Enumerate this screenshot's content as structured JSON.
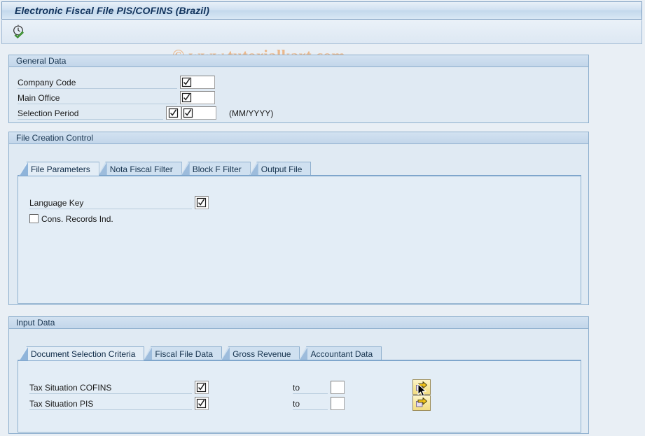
{
  "window": {
    "title": "Electronic Fiscal File PIS/COFINS (Brazil)"
  },
  "toolbar": {
    "execute_tooltip": "Execute",
    "execute_icon": "clock-check-icon"
  },
  "watermark": {
    "text": "© www.tutorialkart.com",
    "color": "#eab88c"
  },
  "general_data": {
    "title": "General Data",
    "fields": [
      {
        "label": "Company Code",
        "value": "",
        "has_value_help": true
      },
      {
        "label": "Main Office",
        "value": "",
        "has_value_help": true
      },
      {
        "label": "Selection Period",
        "value": "",
        "has_value_help": true,
        "extra_value_help": true,
        "hint": "(MM/YYYY)"
      }
    ]
  },
  "file_creation_control": {
    "title": "File Creation Control",
    "tabs": [
      {
        "label": "File Parameters",
        "active": true
      },
      {
        "label": "Nota Fiscal Filter",
        "active": false
      },
      {
        "label": "Block F Filter",
        "active": false
      },
      {
        "label": "Output File",
        "active": false
      }
    ],
    "fields": [
      {
        "label": "Language Key",
        "value": "",
        "has_value_help": true
      }
    ],
    "checkboxes": [
      {
        "label": "Cons. Records Ind.",
        "checked": false
      }
    ]
  },
  "input_data": {
    "title": "Input Data",
    "tabs": [
      {
        "label": "Document Selection Criteria",
        "active": true
      },
      {
        "label": "Fiscal File Data",
        "active": false
      },
      {
        "label": "Gross Revenue",
        "active": false
      },
      {
        "label": "Accountant Data",
        "active": false
      }
    ],
    "range_label": "to",
    "rows": [
      {
        "label": "Tax Situation COFINS",
        "from_value": "",
        "to_value": "",
        "has_value_help": true,
        "multi_select_icon": "multiple-selection-arrow-icon"
      },
      {
        "label": "Tax Situation PIS",
        "from_value": "",
        "to_value": "",
        "has_value_help": true,
        "multi_select_icon": "multiple-selection-arrow-icon"
      }
    ]
  },
  "colors": {
    "page_background": "#e9eff5",
    "group_background": "#e0eaf3",
    "panel_background": "#e3edf6",
    "border": "#8fb0ce",
    "title_text": "#11335c",
    "accent_yellow": "#f7e79a"
  }
}
